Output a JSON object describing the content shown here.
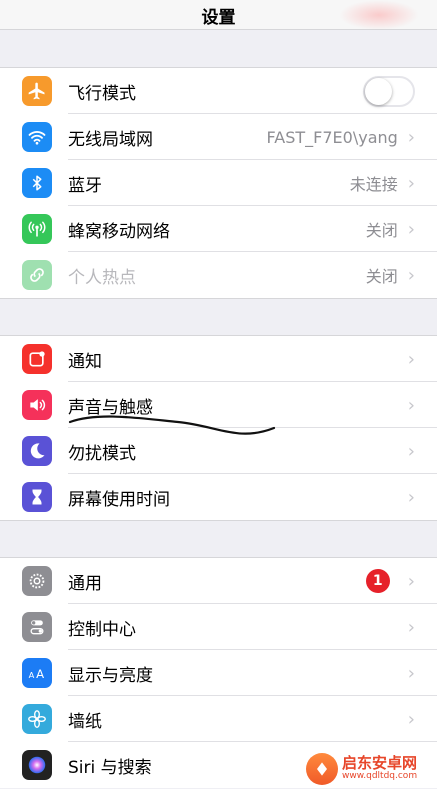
{
  "header": {
    "title": "设置"
  },
  "group1": [
    {
      "label": "飞行模式",
      "icon": "airplane-icon",
      "color": "#f79a2c",
      "toggle": false
    },
    {
      "label": "无线局域网",
      "icon": "wifi-icon",
      "color": "#1c8cf5",
      "value": "FAST_F7E0\\yang"
    },
    {
      "label": "蓝牙",
      "icon": "bluetooth-icon",
      "color": "#1c8cf5",
      "value": "未连接"
    },
    {
      "label": "蜂窝移动网络",
      "icon": "cellular-icon",
      "color": "#35c759",
      "value": "关闭"
    },
    {
      "label": "个人热点",
      "icon": "hotspot-icon",
      "color": "#9fe0b0",
      "value": "关闭",
      "disabled": true
    }
  ],
  "group2": [
    {
      "label": "通知",
      "icon": "notification-icon",
      "color": "#f5312c"
    },
    {
      "label": "声音与触感",
      "icon": "sound-icon",
      "color": "#f5315a"
    },
    {
      "label": "勿扰模式",
      "icon": "moon-icon",
      "color": "#5a52d6"
    },
    {
      "label": "屏幕使用时间",
      "icon": "hourglass-icon",
      "color": "#5a52d6"
    }
  ],
  "group3": [
    {
      "label": "通用",
      "icon": "gear-icon",
      "color": "#8e8e93",
      "badge": "1"
    },
    {
      "label": "控制中心",
      "icon": "control-center-icon",
      "color": "#8e8e93"
    },
    {
      "label": "显示与亮度",
      "icon": "display-icon",
      "color": "#1c7cf5"
    },
    {
      "label": "墙纸",
      "icon": "wallpaper-icon",
      "color": "#34aadc"
    },
    {
      "label": "Siri 与搜索",
      "icon": "siri-icon",
      "color": "#222222"
    }
  ],
  "watermark": {
    "name": "启东安卓网",
    "url": "www.qdltdq.com"
  }
}
